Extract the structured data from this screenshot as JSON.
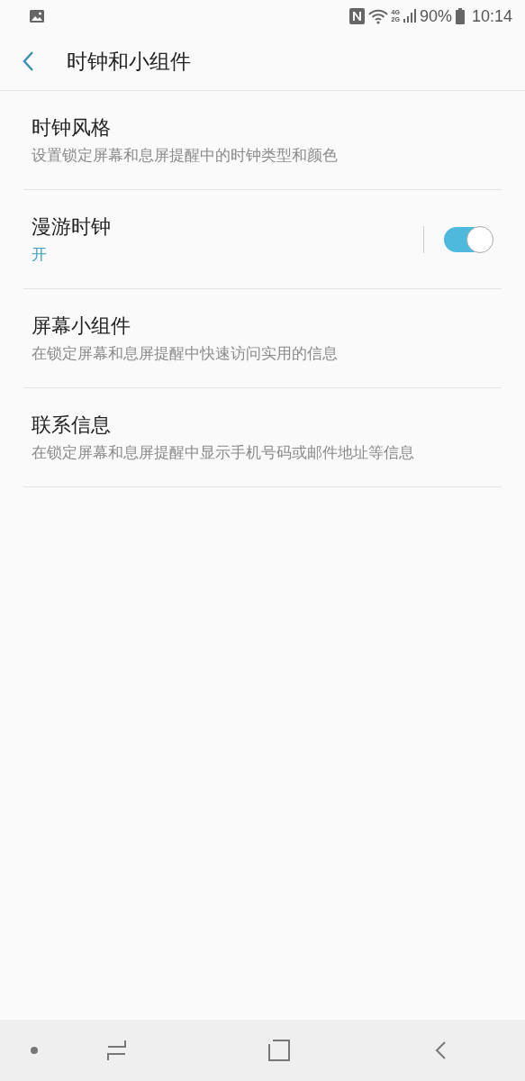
{
  "status_bar": {
    "network_top": "4G",
    "network_bottom": "2G",
    "battery": "90%",
    "time": "10:14"
  },
  "header": {
    "title": "时钟和小组件"
  },
  "items": [
    {
      "kind": "plain",
      "title": "时钟风格",
      "subtitle": "设置锁定屏幕和息屏提醒中的时钟类型和颜色"
    },
    {
      "kind": "toggle",
      "title": "漫游时钟",
      "subtitle": "开",
      "on": true
    },
    {
      "kind": "plain",
      "title": "屏幕小组件",
      "subtitle": "在锁定屏幕和息屏提醒中快速访问实用的信息"
    },
    {
      "kind": "plain",
      "title": "联系信息",
      "subtitle": "在锁定屏幕和息屏提醒中显示手机号码或邮件地址等信息"
    }
  ]
}
